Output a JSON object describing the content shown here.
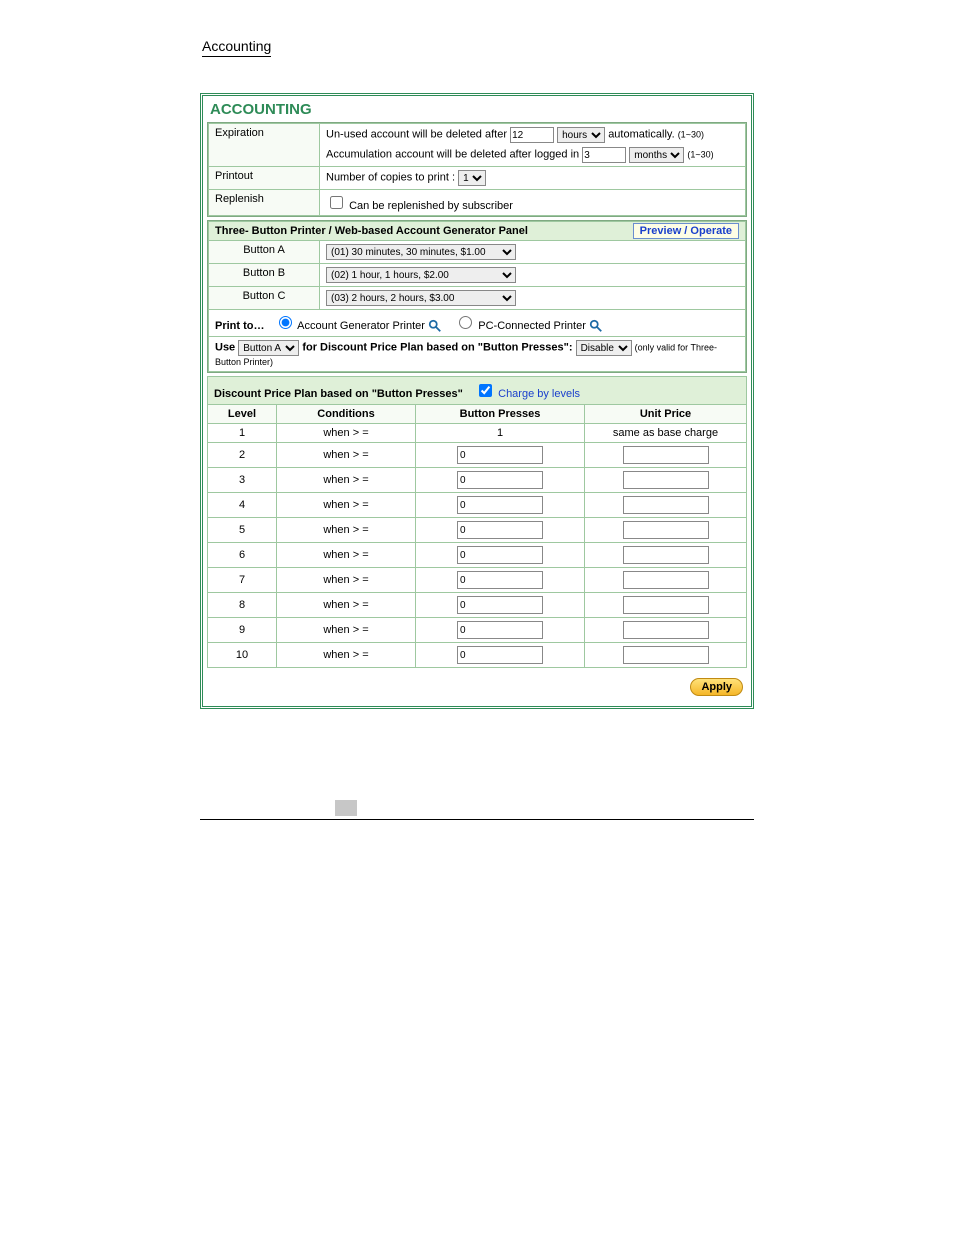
{
  "nav": {
    "accounting_label": "Accounting"
  },
  "panel": {
    "title": "ACCOUNTING"
  },
  "expiration": {
    "label": "Expiration",
    "line1_pre": "Un-used account will be deleted after ",
    "line1_value": "12",
    "line1_unit": "hours",
    "line1_post": " automatically. ",
    "line1_range": "(1~30)",
    "line2_pre": "Accumulation account will be deleted after logged in ",
    "line2_value": "3",
    "line2_unit": "months",
    "line2_range": "(1~30)"
  },
  "printout": {
    "label": "Printout",
    "text_pre": "Number of copies to print : ",
    "copies": "1"
  },
  "replenish": {
    "label": "Replenish",
    "checkbox_label": "Can be replenished by subscriber"
  },
  "three_button": {
    "header_title": "Three- Button Printer / Web-based Account Generator Panel",
    "preview_btn": "Preview / Operate",
    "rows": {
      "a": {
        "label": "Button A",
        "value": "(01) 30 minutes, 30 minutes, $1.00"
      },
      "b": {
        "label": "Button B",
        "value": "(02) 1 hour, 1 hours, $2.00"
      },
      "c": {
        "label": "Button C",
        "value": "(03) 2 hours, 2 hours, $3.00"
      }
    },
    "print_to_label": "Print to…",
    "radio1": "Account Generator Printer",
    "radio2": "PC-Connected Printer",
    "use_pre": "Use ",
    "use_select": "Button A",
    "use_mid": "  for Discount Price Plan based on \"Button Presses\": ",
    "use_state": "Disable",
    "use_post": " (only valid for Three-Button Printer)"
  },
  "discount": {
    "title": "Discount Price Plan based on \"Button Presses\"",
    "checkbox_label": "Charge by levels",
    "columns": {
      "level": "Level",
      "conditions": "Conditions",
      "presses": "Button Presses",
      "price": "Unit Price"
    },
    "cond_text": "when  > =",
    "rows": [
      {
        "level": "1",
        "presses_text": "1",
        "price_text": "same as base charge",
        "editable": false
      },
      {
        "level": "2",
        "presses_value": "0",
        "editable": true
      },
      {
        "level": "3",
        "presses_value": "0",
        "editable": true
      },
      {
        "level": "4",
        "presses_value": "0",
        "editable": true
      },
      {
        "level": "5",
        "presses_value": "0",
        "editable": true
      },
      {
        "level": "6",
        "presses_value": "0",
        "editable": true
      },
      {
        "level": "7",
        "presses_value": "0",
        "editable": true
      },
      {
        "level": "8",
        "presses_value": "0",
        "editable": true
      },
      {
        "level": "9",
        "presses_value": "0",
        "editable": true
      },
      {
        "level": "10",
        "presses_value": "0",
        "editable": true
      }
    ]
  },
  "apply": {
    "label": "Apply"
  }
}
